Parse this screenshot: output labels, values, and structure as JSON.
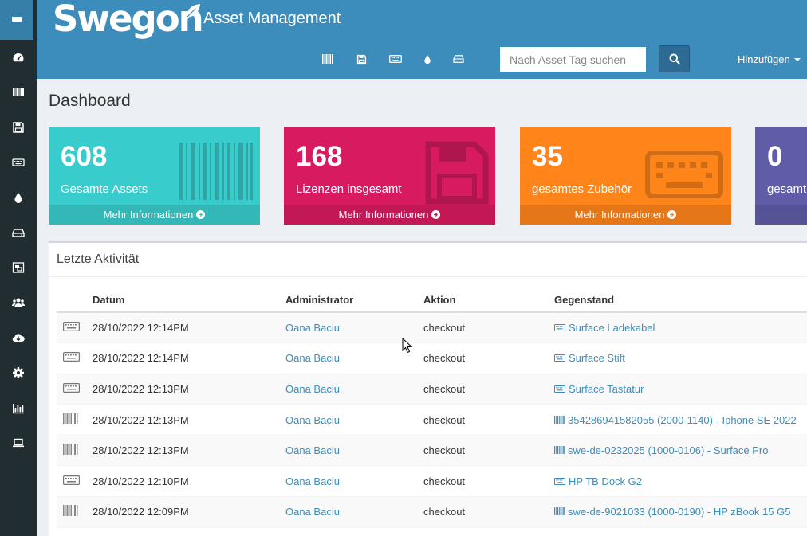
{
  "header": {
    "logo": "Swegon",
    "app_name": "Asset Management",
    "search_placeholder": "Nach Asset Tag suchen",
    "add_menu": "Hinzufügen"
  },
  "page_title": "Dashboard",
  "stats": [
    {
      "value": "608",
      "label": "Gesamte Assets",
      "more": "Mehr Informationen",
      "color": "#39cccc"
    },
    {
      "value": "168",
      "label": "Lizenzen insgesamt",
      "more": "Mehr Informationen",
      "color": "#d81b60"
    },
    {
      "value": "35",
      "label": "gesamtes Zubehör",
      "more": "Mehr Informationen",
      "color": "#ff851b"
    },
    {
      "value": "0",
      "label": "gesamte",
      "more": "",
      "color": "#605ca8"
    }
  ],
  "activity": {
    "title": "Letzte Aktivität",
    "columns": [
      "Datum",
      "Administrator",
      "Aktion",
      "Gegenstand"
    ],
    "rows": [
      {
        "icon": "keyboard-icon",
        "date": "28/10/2022 12:14PM",
        "admin": "Oana Baciu",
        "action": "checkout",
        "item_icon": "keyboard-icon",
        "item": "Surface Ladekabel"
      },
      {
        "icon": "keyboard-icon",
        "date": "28/10/2022 12:14PM",
        "admin": "Oana Baciu",
        "action": "checkout",
        "item_icon": "keyboard-icon",
        "item": "Surface Stift"
      },
      {
        "icon": "keyboard-icon",
        "date": "28/10/2022 12:13PM",
        "admin": "Oana Baciu",
        "action": "checkout",
        "item_icon": "keyboard-icon",
        "item": "Surface Tastatur"
      },
      {
        "icon": "barcode-icon",
        "date": "28/10/2022 12:13PM",
        "admin": "Oana Baciu",
        "action": "checkout",
        "item_icon": "barcode-icon",
        "item": "354286941582055 (2000-1140) - Iphone SE 2022"
      },
      {
        "icon": "barcode-icon",
        "date": "28/10/2022 12:13PM",
        "admin": "Oana Baciu",
        "action": "checkout",
        "item_icon": "barcode-icon",
        "item": "swe-de-0232025 (1000-0106) - Surface Pro"
      },
      {
        "icon": "keyboard-icon",
        "date": "28/10/2022 12:10PM",
        "admin": "Oana Baciu",
        "action": "checkout",
        "item_icon": "keyboard-icon",
        "item": "HP TB Dock G2"
      },
      {
        "icon": "barcode-icon",
        "date": "28/10/2022 12:09PM",
        "admin": "Oana Baciu",
        "action": "checkout",
        "item_icon": "barcode-icon",
        "item": "swe-de-9021033 (1000-0190) - HP zBook 15 G5"
      }
    ]
  }
}
